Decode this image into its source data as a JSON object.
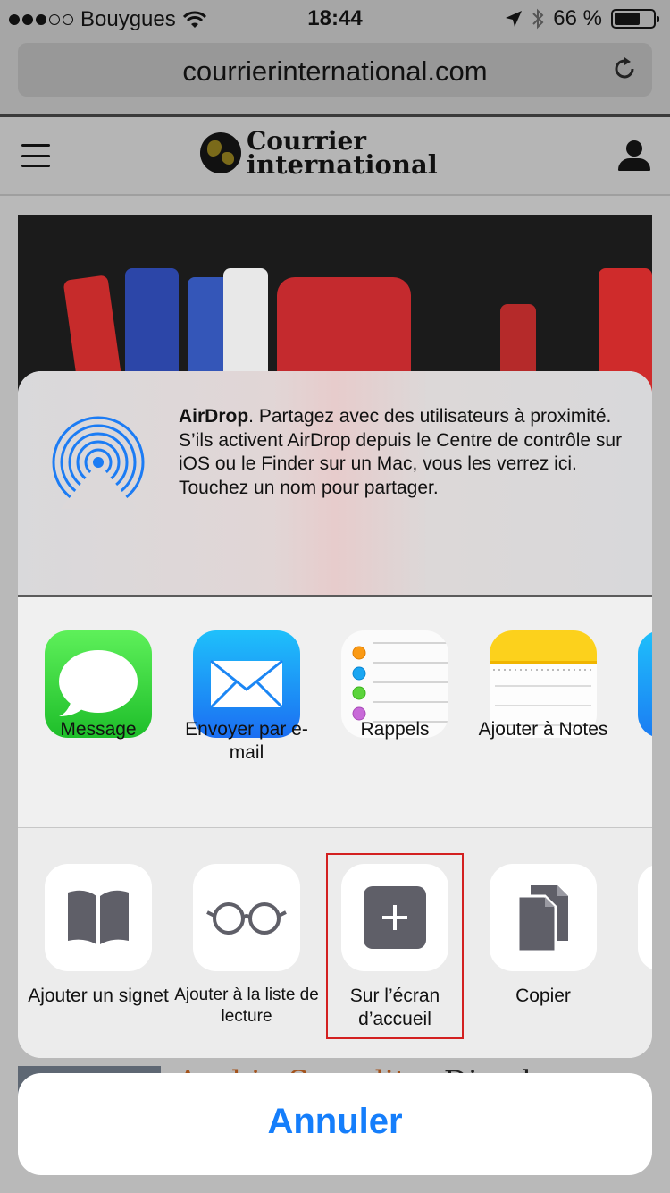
{
  "status_bar": {
    "carrier": "Bouygues",
    "time": "18:44",
    "battery": "66 %",
    "battery_level": 0.66
  },
  "browser": {
    "url": "courrierinternational.com"
  },
  "site": {
    "logo_line1": "Courrier",
    "logo_line2": "international"
  },
  "article": {
    "kicker": "Arabie Saoudite.",
    "title": "Dix ch",
    "accent_color": "#a3531d"
  },
  "share_sheet": {
    "airdrop": {
      "title": "AirDrop",
      "text": ". Partagez avec des utilisateurs à proximité. S’ils activent AirDrop depuis le Centre de contrôle sur iOS ou le Finder sur un Mac, vous les verrez ici. Touchez un nom pour partager.",
      "icon": "airdrop-icon",
      "color": "#1c7cf4"
    },
    "apps": [
      {
        "label": "Message",
        "icon": "messages-icon"
      },
      {
        "label": "Envoyer par e-mail",
        "icon": "mail-icon"
      },
      {
        "label": "Rappels",
        "icon": "reminders-icon"
      },
      {
        "label": "Ajouter à Notes",
        "icon": "notes-icon"
      }
    ],
    "actions": [
      {
        "label": "Ajouter un signet",
        "icon": "bookmark-icon"
      },
      {
        "label": "Ajouter à la liste de lecture",
        "icon": "reading-list-icon"
      },
      {
        "label": "Sur l’écran d’accueil",
        "icon": "add-to-home-icon",
        "highlighted": true
      },
      {
        "label": "Copier",
        "icon": "copy-icon"
      }
    ],
    "cancel_label": "Annuler",
    "accent_color": "#157efb"
  }
}
